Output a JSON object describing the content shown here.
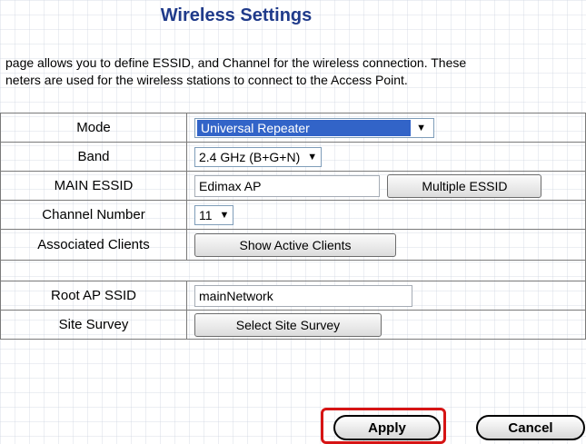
{
  "page": {
    "title": "Wireless Settings",
    "intro_line1": "page allows you to define ESSID, and Channel for the wireless connection. These",
    "intro_line2": "neters are used for the wireless stations to connect to the Access Point."
  },
  "form": {
    "mode": {
      "label": "Mode",
      "value": "Universal Repeater"
    },
    "band": {
      "label": "Band",
      "value": "2.4 GHz (B+G+N)"
    },
    "main_essid": {
      "label": "MAIN ESSID",
      "value": "Edimax AP",
      "button": "Multiple ESSID"
    },
    "channel": {
      "label": "Channel Number",
      "value": "11"
    },
    "clients": {
      "label": "Associated Clients",
      "button": "Show Active Clients"
    },
    "root_ap_ssid": {
      "label": "Root AP SSID",
      "value": "mainNetwork"
    },
    "site_survey": {
      "label": "Site Survey",
      "button": "Select Site Survey"
    }
  },
  "actions": {
    "apply": "Apply",
    "cancel": "Cancel"
  },
  "colors": {
    "title": "#1f3a8a",
    "selection": "#3264c8",
    "highlight": "#d61414"
  },
  "icons": {
    "dropdown": "chevron-down-icon"
  }
}
